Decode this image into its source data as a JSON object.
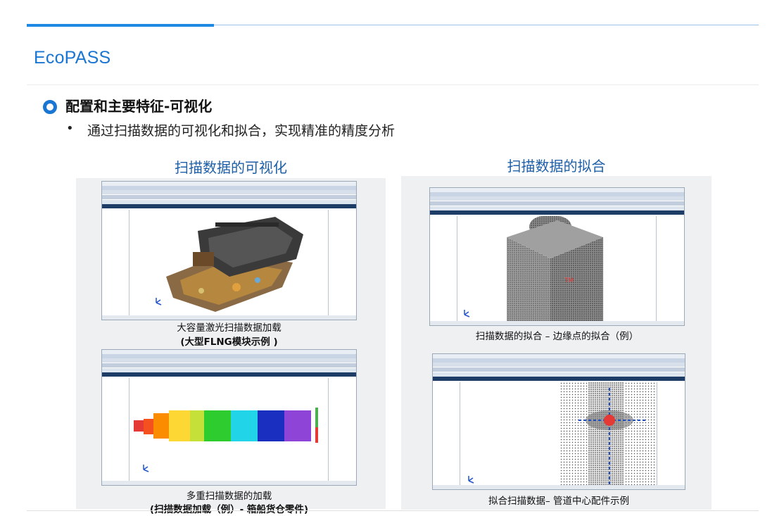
{
  "brand": "EcoPASS",
  "section": {
    "heading": "配置和主要特征-可视化",
    "bullet": "•",
    "point": "通过扫描数据的可视化和拟合，实现精准的精度分析"
  },
  "columns": [
    {
      "title": "扫描数据的可视化"
    },
    {
      "title": "扫描数据的拟合"
    }
  ],
  "captions": {
    "top_left_line1": "大容量激光扫描数据加载",
    "top_left_line2": "(大型FLNG模块示例 )",
    "bottom_left_line1": "多重扫描数据的加载",
    "bottom_left_line2": "(扫描数据加载（例）- 箱船货仓零件)",
    "top_right_line1": "扫描数据的拟合 – 边缘点的拟合（例）",
    "bottom_right_line1": "拟合扫描数据– 管道中心配件示例"
  },
  "colors": {
    "accent": "#1976d2",
    "title_blue": "#1e5fa8",
    "app_tab_bar": "#1d3d66"
  }
}
